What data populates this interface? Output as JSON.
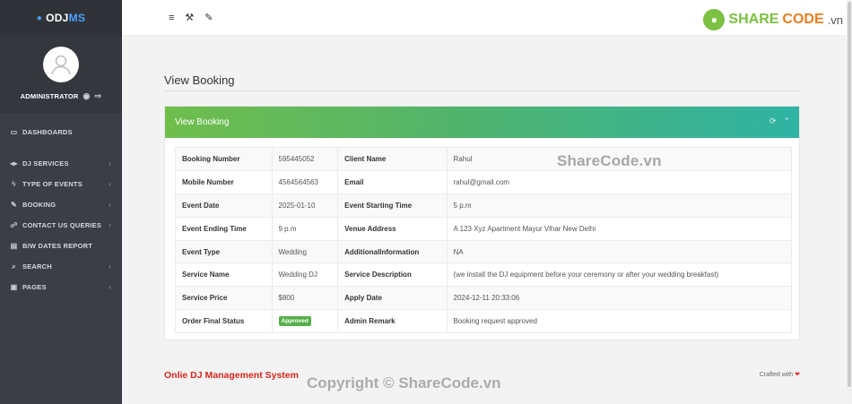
{
  "brand": {
    "prefix": "ODJ",
    "suffix": "MS"
  },
  "profile": {
    "name": "ADMINISTRATOR"
  },
  "nav": [
    {
      "label": "DASHBOARDS",
      "icon": "dashboard-icon",
      "glyph": "▭",
      "chevron": false
    },
    {
      "label": "DJ SERVICES",
      "icon": "music-icon",
      "glyph": "◂▸",
      "chevron": true
    },
    {
      "label": "TYPE OF EVENTS",
      "icon": "bolt-icon",
      "glyph": "ϟ",
      "chevron": true
    },
    {
      "label": "BOOKING",
      "icon": "edit-icon",
      "glyph": "✎",
      "chevron": true
    },
    {
      "label": "CONTACT US QUERIES",
      "icon": "users-icon",
      "glyph": "☍",
      "chevron": true
    },
    {
      "label": "B/W DATES REPORT",
      "icon": "file-icon",
      "glyph": "▤",
      "chevron": false
    },
    {
      "label": "SEARCH",
      "icon": "search-icon",
      "glyph": "⌕",
      "chevron": true
    },
    {
      "label": "PAGES",
      "icon": "pages-icon",
      "glyph": "▣",
      "chevron": true
    }
  ],
  "topbar": {
    "menu": "≡",
    "wrench": "🔧",
    "brush": "🖌"
  },
  "logo": {
    "share": "SHARE",
    "code": "CODE",
    "vn": ".vn"
  },
  "page": {
    "title": "View Booking"
  },
  "panel": {
    "title": "View Booking"
  },
  "watermark": "ShareCode.vn",
  "rows": [
    [
      {
        "k": "Booking Number",
        "v": "595445052"
      },
      {
        "k": "Client Name",
        "v": "Rahul"
      }
    ],
    [
      {
        "k": "Mobile Number",
        "v": "4564564563"
      },
      {
        "k": "Email",
        "v": "rahul@gmail.com"
      }
    ],
    [
      {
        "k": "Event Date",
        "v": "2025-01-10"
      },
      {
        "k": "Event Starting Time",
        "v": "5 p.m"
      }
    ],
    [
      {
        "k": "Event Ending Time",
        "v": "9 p.m"
      },
      {
        "k": "Venue Address",
        "v": "A 123 Xyz Apartment Mayur Vihar New Delhi"
      }
    ],
    [
      {
        "k": "Event Type",
        "v": "Wedding"
      },
      {
        "k": "AdditionalInformation",
        "v": "NA"
      }
    ],
    [
      {
        "k": "Service Name",
        "v": "Wedding DJ"
      },
      {
        "k": "Service Description",
        "v": "(we install the DJ equipment before your ceremony or after your wedding breakfast)"
      }
    ],
    [
      {
        "k": "Service Price",
        "v": "$800"
      },
      {
        "k": "Apply Date",
        "v": "2024-12-11 20:33:06"
      }
    ],
    [
      {
        "k": "Order Final Status",
        "v": "Approved",
        "badge": true
      },
      {
        "k": "Admin Remark",
        "v": "Booking request approved"
      }
    ]
  ],
  "footer": {
    "left": "Onlie DJ Management System",
    "right": "Crafted with"
  },
  "copyright": "Copyright © ShareCode.vn"
}
